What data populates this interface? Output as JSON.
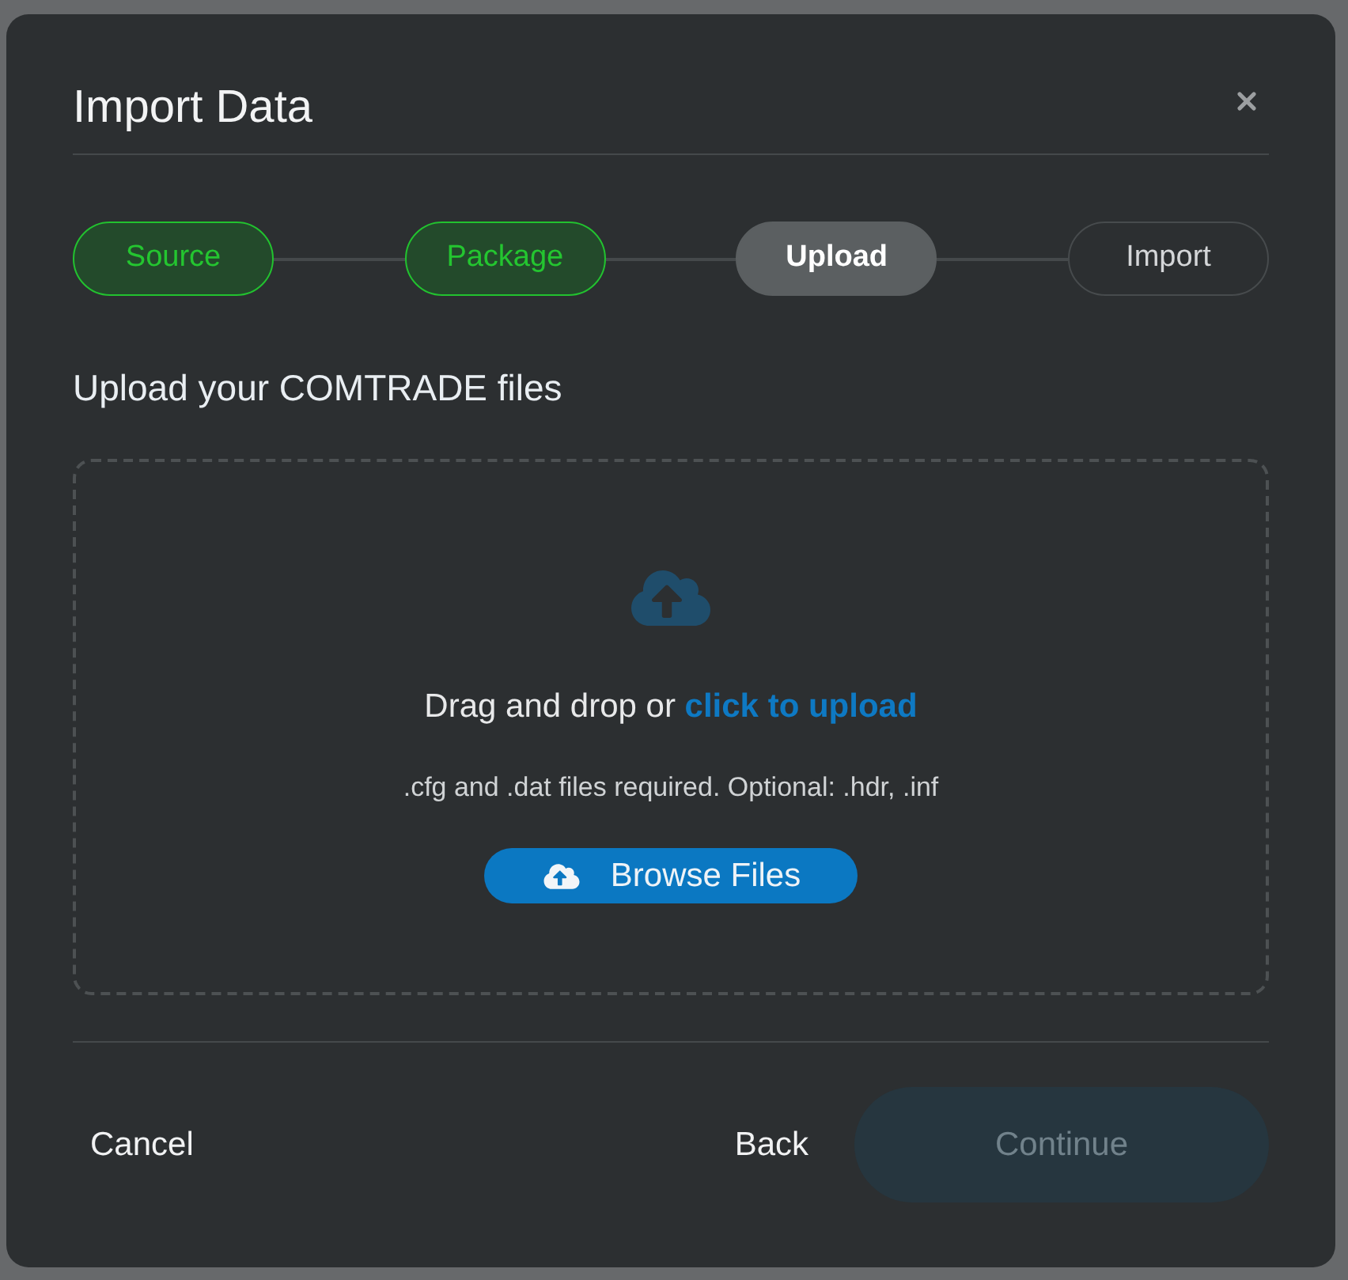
{
  "dialog": {
    "title": "Import Data"
  },
  "steps": [
    {
      "label": "Source",
      "complete": true,
      "selected": false
    },
    {
      "label": "Package",
      "complete": true,
      "selected": false
    },
    {
      "label": "Upload",
      "complete": false,
      "selected": true
    },
    {
      "label": "Import",
      "complete": false,
      "selected": false
    }
  ],
  "upload": {
    "heading": "Upload your COMTRADE files",
    "prompt": "Drag and drop or",
    "link": "click to upload",
    "hint": ".cfg and .dat files required. Optional: .hdr, .inf",
    "browse_button": "Browse Files"
  },
  "footer": {
    "cancel": "Cancel",
    "back": "Back",
    "continue": {
      "label": "Continue",
      "disabled": true
    }
  }
}
